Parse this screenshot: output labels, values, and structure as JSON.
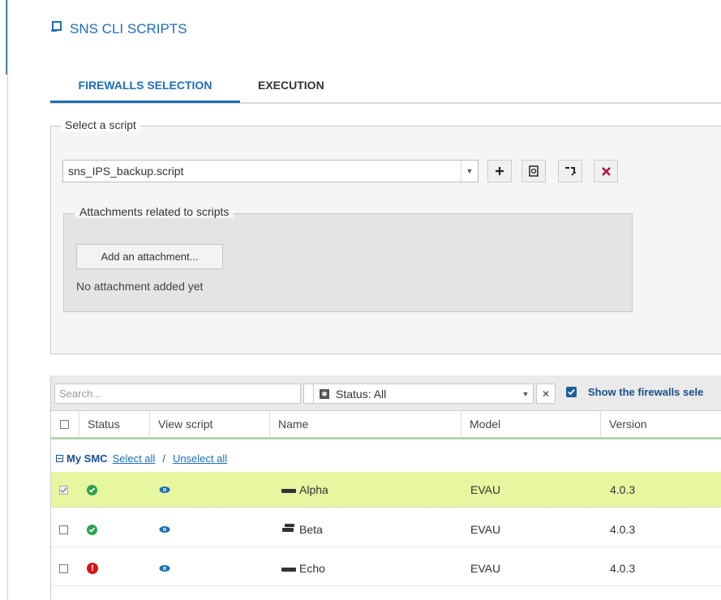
{
  "app": {
    "title": "SNS CLI SCRIPTS",
    "title_icon": "script-icon"
  },
  "tabs": [
    {
      "label": "FIREWALLS SELECTION",
      "active": true
    },
    {
      "label": "EXECUTION",
      "active": false
    }
  ],
  "script_section": {
    "legend": "Select a script",
    "selected_script": "sns_IPS_backup.script",
    "buttons": [
      {
        "name": "add-script-button",
        "icon": "plus-icon"
      },
      {
        "name": "view-script-button",
        "icon": "preview-icon"
      },
      {
        "name": "import-script-button",
        "icon": "import-icon"
      },
      {
        "name": "delete-script-button",
        "icon": "close-icon"
      }
    ]
  },
  "attachments": {
    "legend": "Attachments related to scripts",
    "add_button": "Add an attachment...",
    "empty_text": "No attachment added yet"
  },
  "filters": {
    "search_placeholder": "Search...",
    "status_label": "Status: All",
    "show_firewalls_label": "Show the firewalls sele",
    "show_firewalls_checked": true
  },
  "table": {
    "columns": [
      "Status",
      "View script",
      "Name",
      "Model",
      "Version"
    ],
    "group": {
      "name": "My SMC",
      "select_all": "Select all",
      "separator": "/",
      "unselect_all": "Unselect all"
    },
    "rows": [
      {
        "selected": true,
        "status": "ok",
        "name": "Alpha",
        "model": "EVAU",
        "version": "4.0.3",
        "device_icon": "firewall-single-icon"
      },
      {
        "selected": false,
        "status": "ok",
        "name": "Beta",
        "model": "EVAU",
        "version": "4.0.3",
        "device_icon": "firewall-cluster-icon"
      },
      {
        "selected": false,
        "status": "error",
        "name": "Echo",
        "model": "EVAU",
        "version": "4.0.3",
        "device_icon": "firewall-single-icon"
      }
    ]
  },
  "colors": {
    "accent": "#1d6eb7",
    "selected_row": "#e6f7a0",
    "ok": "#29a349",
    "error": "#d9131a",
    "delete": "#b0103a"
  }
}
